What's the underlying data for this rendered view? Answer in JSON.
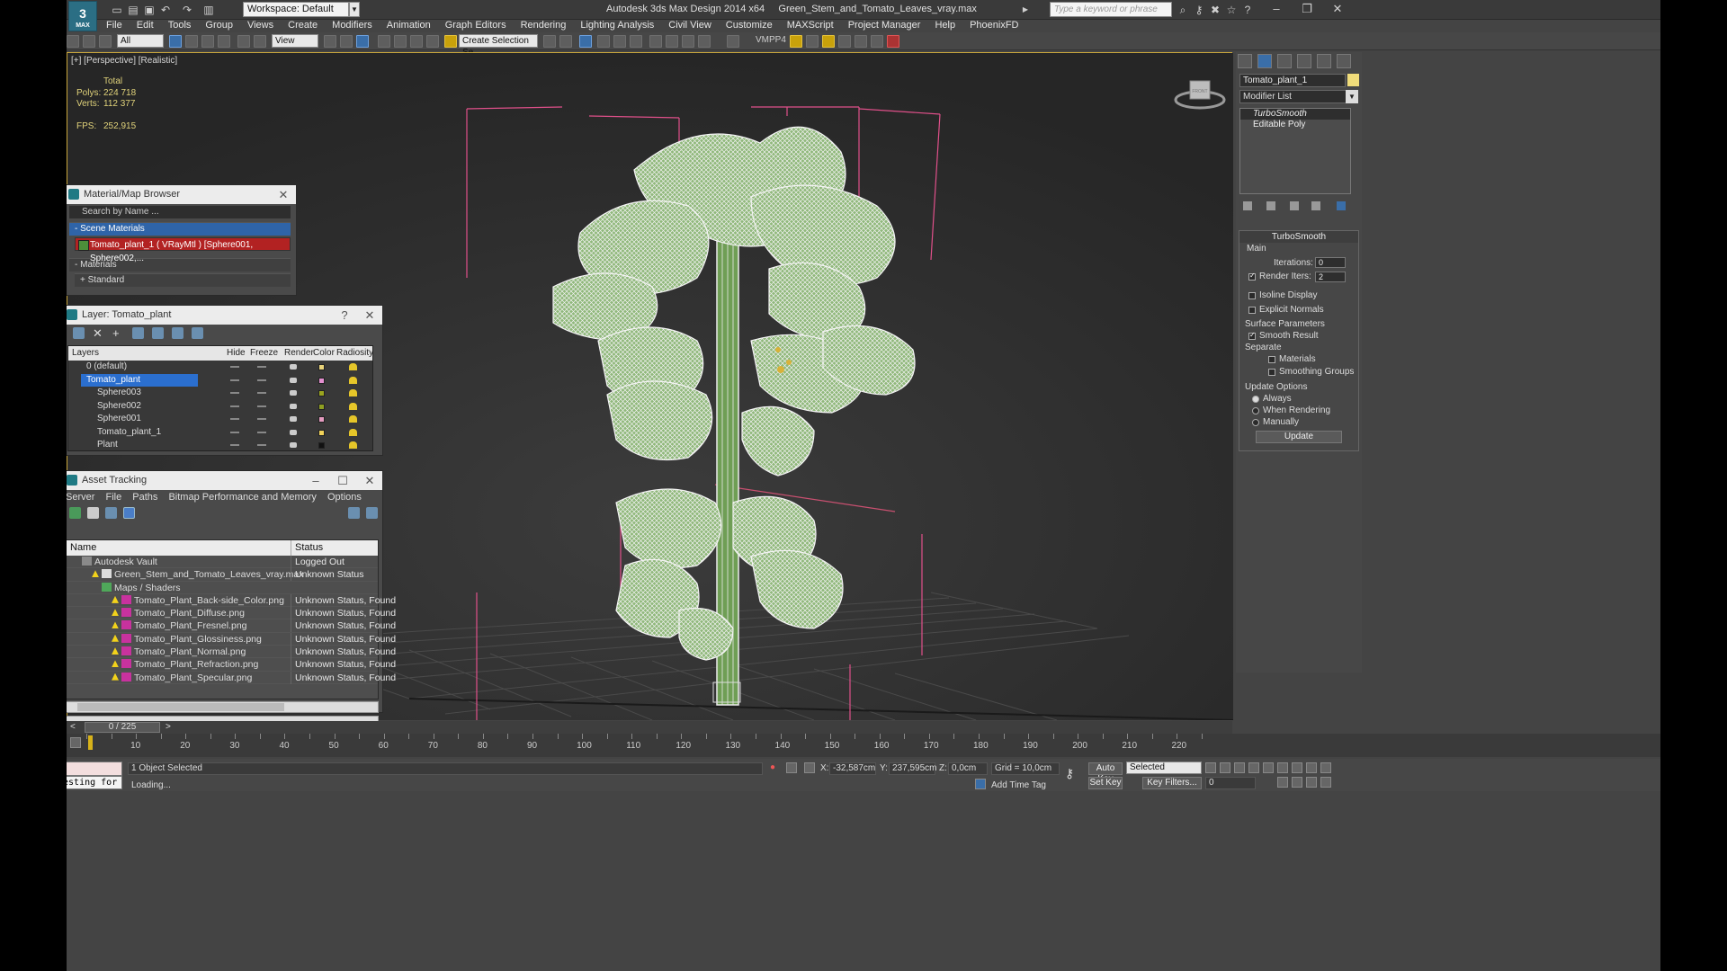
{
  "titlebar": {
    "app_icon_label": "MAX",
    "workspace": "Workspace: Default",
    "title": "Autodesk 3ds Max Design 2014 x64     Green_Stem_and_Tomato_Leaves_vray.max",
    "search_placeholder": "Type a keyword or phrase"
  },
  "menu": [
    "File",
    "Edit",
    "Tools",
    "Group",
    "Views",
    "Create",
    "Modifiers",
    "Animation",
    "Graph Editors",
    "Rendering",
    "Lighting Analysis",
    "Civil View",
    "Customize",
    "MAXScript",
    "Project Manager",
    "Help",
    "PhoenixFD"
  ],
  "toolbar": {
    "selection_filter": "All",
    "ref_coord": "View",
    "named_selection": "Create Selection Se",
    "vmpp": "VMPP4"
  },
  "viewport": {
    "label": "[+] [Perspective] [Realistic]",
    "stats_header": "Total",
    "polys_label": "Polys:",
    "polys": "224 718",
    "verts_label": "Verts:",
    "verts": "112 377",
    "fps_label": "FPS:",
    "fps": "252,915",
    "viewcube_label": "FRONT"
  },
  "material_browser": {
    "title": "Material/Map Browser",
    "search_placeholder": "Search by Name ...",
    "scene_materials": "- Scene Materials",
    "material_entry": "Tomato_plant_1  ( VRayMtl ) [Sphere001, Sphere002,...",
    "materials": "- Materials",
    "standard": "+ Standard"
  },
  "layer_panel": {
    "title": "Layer: Tomato_plant",
    "help_btn": "?",
    "columns": {
      "layers": "Layers",
      "hide": "Hide",
      "freeze": "Freeze",
      "render": "Render",
      "color": "Color",
      "radiosity": "Radiosity"
    },
    "rows": [
      {
        "name": "0 (default)",
        "color": "#e8d37a",
        "indent": 0,
        "selected": false
      },
      {
        "name": "Tomato_plant",
        "color": "#e38fcf",
        "indent": 0,
        "selected": true
      },
      {
        "name": "Sphere003",
        "color": "#9ba51f",
        "indent": 1,
        "selected": false
      },
      {
        "name": "Sphere002",
        "color": "#8f9f22",
        "indent": 1,
        "selected": false
      },
      {
        "name": "Sphere001",
        "color": "#e59bc0",
        "indent": 1,
        "selected": false
      },
      {
        "name": "Tomato_plant_1",
        "color": "#f2d35a",
        "indent": 1,
        "selected": false
      },
      {
        "name": "Plant",
        "color": "#111111",
        "indent": 1,
        "selected": false
      }
    ]
  },
  "asset_tracking": {
    "title": "Asset Tracking",
    "menu": [
      "Server",
      "File",
      "Paths",
      "Bitmap Performance and Memory",
      "Options"
    ],
    "columns": {
      "name": "Name",
      "status": "Status"
    },
    "rows": [
      {
        "name": "Autodesk Vault",
        "status": "Logged Out",
        "indent": 1,
        "icon": "vault"
      },
      {
        "name": "Green_Stem_and_Tomato_Leaves_vray.max",
        "status": "Unknown Status",
        "indent": 2,
        "icon": "max"
      },
      {
        "name": "Maps / Shaders",
        "status": "",
        "indent": 3,
        "icon": "folder"
      },
      {
        "name": "Tomato_Plant_Back-side_Color.png",
        "status": "Unknown Status, Found",
        "indent": 4,
        "icon": "png"
      },
      {
        "name": "Tomato_Plant_Diffuse.png",
        "status": "Unknown Status, Found",
        "indent": 4,
        "icon": "png"
      },
      {
        "name": "Tomato_Plant_Fresnel.png",
        "status": "Unknown Status, Found",
        "indent": 4,
        "icon": "png"
      },
      {
        "name": "Tomato_Plant_Glossiness.png",
        "status": "Unknown Status, Found",
        "indent": 4,
        "icon": "png"
      },
      {
        "name": "Tomato_Plant_Normal.png",
        "status": "Unknown Status, Found",
        "indent": 4,
        "icon": "png"
      },
      {
        "name": "Tomato_Plant_Refraction.png",
        "status": "Unknown Status, Found",
        "indent": 4,
        "icon": "png"
      },
      {
        "name": "Tomato_Plant_Specular.png",
        "status": "Unknown Status, Found",
        "indent": 4,
        "icon": "png"
      }
    ]
  },
  "command_panel": {
    "object_name": "Tomato_plant_1",
    "modifier_list": "Modifier List",
    "stack": [
      "TurboSmooth",
      "Editable Poly"
    ],
    "rollout_title": "TurboSmooth",
    "main_label": "Main",
    "iterations_label": "Iterations:",
    "iterations": "0",
    "render_iters_label": "Render Iters:",
    "render_iters": "2",
    "isoline_display": "Isoline Display",
    "explicit_normals": "Explicit Normals",
    "surface_params": "Surface Parameters",
    "smooth_result": "Smooth Result",
    "separate": "Separate",
    "materials": "Materials",
    "smoothing_groups": "Smoothing Groups",
    "update_options": "Update Options",
    "always": "Always",
    "when_rendering": "When Rendering",
    "manually": "Manually",
    "update": "Update"
  },
  "timeline": {
    "frame": "0 / 225",
    "ticks": [
      0,
      5,
      10,
      15,
      20,
      25,
      30,
      35,
      40,
      45,
      50,
      55,
      60,
      65,
      70,
      75,
      80,
      85,
      90,
      95,
      100,
      105,
      110,
      115,
      120,
      125,
      130,
      135,
      140,
      145,
      150,
      155,
      160,
      165,
      170,
      175,
      180,
      185,
      190,
      195,
      200,
      205,
      210,
      215,
      220,
      225
    ],
    "labels": [
      10,
      20,
      30,
      40,
      50,
      60,
      70,
      80,
      90,
      100,
      110,
      120,
      130,
      140,
      150,
      160,
      170,
      180,
      190,
      200,
      210,
      220
    ],
    "max_frame": 225
  },
  "statusbar": {
    "maxscript_text": "Testing for ,",
    "selection_status": "1 Object Selected",
    "prompt": "Loading...",
    "x_label": "X:",
    "x": "-32,587cm",
    "y_label": "Y:",
    "y": "237,595cm",
    "z_label": "Z:",
    "z": "0,0cm",
    "grid": "Grid = 10,0cm",
    "add_time_tag": "Add Time Tag",
    "auto_key": "Auto Key",
    "set_key": "Set Key",
    "selected": "Selected",
    "key_filters": "Key Filters...",
    "frame_field": "0"
  }
}
